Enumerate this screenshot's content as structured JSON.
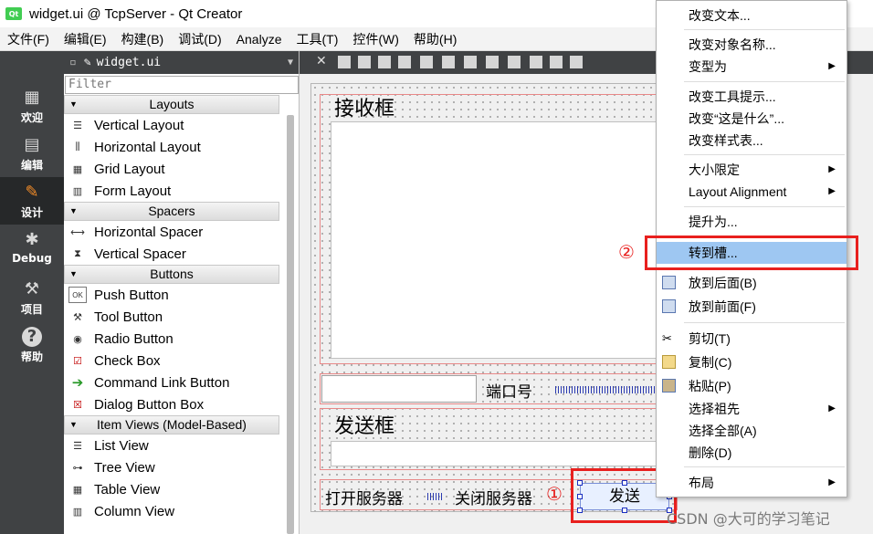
{
  "window": {
    "title": "widget.ui @ TcpServer - Qt Creator",
    "logo": "Qt"
  },
  "menubar": [
    "文件(F)",
    "编辑(E)",
    "构建(B)",
    "调试(D)",
    "Analyze",
    "工具(T)",
    "控件(W)",
    "帮助(H)"
  ],
  "modes": [
    {
      "label": "欢迎",
      "icon": "grid-icon"
    },
    {
      "label": "编辑",
      "icon": "document-icon"
    },
    {
      "label": "设计",
      "icon": "pencil-icon"
    },
    {
      "label": "Debug",
      "icon": "bug-icon"
    },
    {
      "label": "项目",
      "icon": "wrench-icon"
    },
    {
      "label": "帮助",
      "icon": "help-icon"
    }
  ],
  "widgetbox": {
    "file": "widget.ui",
    "filter_placeholder": "Filter",
    "categories": {
      "layouts": "Layouts",
      "spacers": "Spacers",
      "buttons": "Buttons",
      "item_views": "Item Views (Model-Based)"
    },
    "layouts": [
      "Vertical Layout",
      "Horizontal Layout",
      "Grid Layout",
      "Form Layout"
    ],
    "spacers": [
      "Horizontal Spacer",
      "Vertical Spacer"
    ],
    "buttons": [
      "Push Button",
      "Tool Button",
      "Radio Button",
      "Check Box",
      "Command Link Button",
      "Dialog Button Box"
    ],
    "item_views": [
      "List View",
      "Tree View",
      "Table View",
      "Column View"
    ]
  },
  "form": {
    "recv_label": "接收框",
    "port_label": "端口号",
    "send_label": "发送框",
    "open_button": "打开服务器",
    "close_button": "关闭服务器",
    "send_button": "发送"
  },
  "annotations": {
    "marker1": "①",
    "marker2": "②"
  },
  "context_menu": {
    "change_text": "改变文本...",
    "change_object_name": "改变对象名称...",
    "morph_into": "变型为",
    "change_tooltip": "改变工具提示...",
    "change_whatsthis": "改变“这是什么”...",
    "change_stylesheet": "改变样式表...",
    "size_constraints": "大小限定",
    "layout_alignment": "Layout Alignment",
    "promote_to": "提升为...",
    "go_to_slot": "转到槽...",
    "send_to_back": "放到后面(B)",
    "bring_to_front": "放到前面(F)",
    "cut": "剪切(T)",
    "copy": "复制(C)",
    "paste": "粘贴(P)",
    "select_ancestor": "选择祖先",
    "select_all": "选择全部(A)",
    "delete": "删除(D)",
    "layout": "布局"
  },
  "watermark": "CSDN @大可的学习笔记",
  "colors": {
    "highlight": "#9ec7f2",
    "annotation_red": "#e8201e",
    "modebar": "#404244"
  }
}
